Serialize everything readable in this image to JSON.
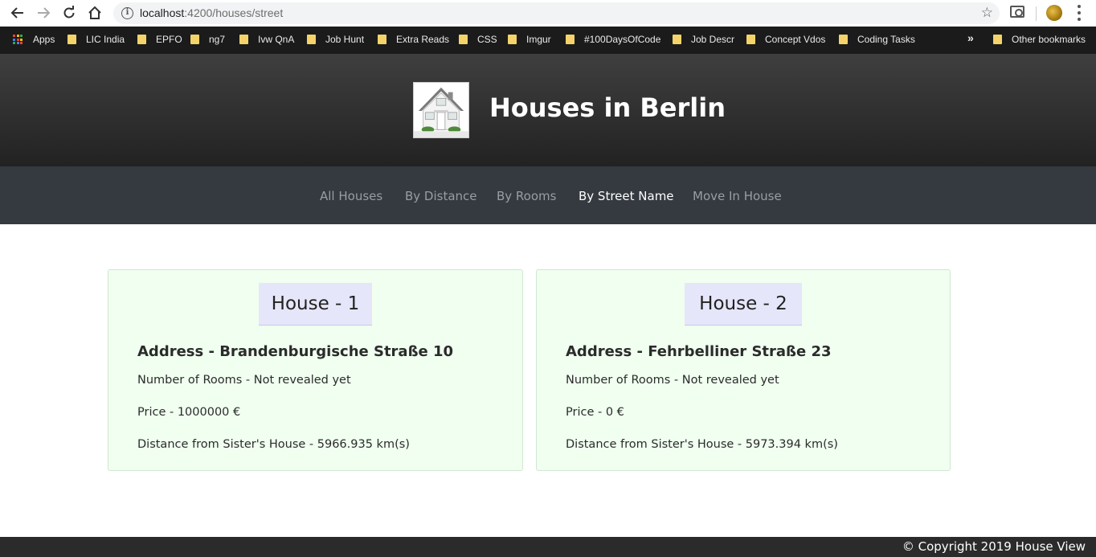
{
  "browser": {
    "url_host": "localhost",
    "url_path": ":4200/houses/street",
    "bookmarks": [
      "Apps",
      "LIC India",
      "EPFO",
      "ng7",
      "Ivw QnA",
      "Job Hunt",
      "Extra Reads",
      "CSS",
      "Imgur",
      "#100DaysOfCode",
      "Job Descr",
      "Concept Vdos",
      "Coding Tasks"
    ],
    "overflow_label": "»",
    "other_bookmarks": "Other bookmarks"
  },
  "header": {
    "title": "Houses in Berlin"
  },
  "nav": {
    "items": [
      {
        "label": "All Houses",
        "active": false
      },
      {
        "label": "By Distance",
        "active": false
      },
      {
        "label": "By Rooms",
        "active": false
      },
      {
        "label": "By Street Name",
        "active": true
      },
      {
        "label": "Move In House",
        "active": false
      }
    ]
  },
  "houses": [
    {
      "title": "House - 1",
      "address": "Address - Brandenburgische Straße 10",
      "rooms": "Number of Rooms - Not revealed yet",
      "price": "Price - 1000000 €",
      "distance": "Distance from Sister's House - 5966.935 km(s)"
    },
    {
      "title": "House - 2",
      "address": "Address - Fehrbelliner Straße 23",
      "rooms": "Number of Rooms - Not revealed yet",
      "price": "Price - 0 €",
      "distance": "Distance from Sister's House - 5973.394 km(s)"
    }
  ],
  "footer": {
    "copyright": "© Copyright 2019 House View"
  },
  "colors": {
    "nav_bg": "#343a40",
    "card_bg": "#f0fff0",
    "card_title_bg": "#e6e6fa",
    "header_bg": "#2b2b2b"
  }
}
